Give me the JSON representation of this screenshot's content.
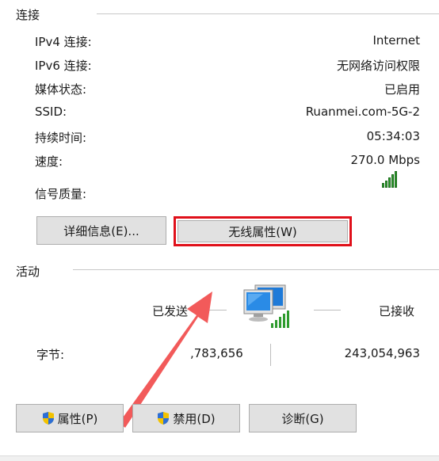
{
  "connection": {
    "group_title": "连接",
    "rows": [
      {
        "label": "IPv4 连接:",
        "value": "Internet"
      },
      {
        "label": "IPv6 连接:",
        "value": "无网络访问权限"
      },
      {
        "label": "媒体状态:",
        "value": "已启用"
      },
      {
        "label": "SSID:",
        "value": "Ruanmei.com-5G-2"
      },
      {
        "label": "持续时间:",
        "value": "05:34:03"
      },
      {
        "label": "速度:",
        "value": "270.0 Mbps"
      }
    ],
    "signal_label": "信号质量:",
    "signal_bars": 5,
    "details_button": "详细信息(E)...",
    "wireless_props_button": "无线属性(W)"
  },
  "activity": {
    "group_title": "活动",
    "sent_label": "已发送",
    "received_label": "已接收",
    "bytes_label": "字节:",
    "bytes_sent": ",783,656",
    "bytes_received": "243,054,963"
  },
  "buttons": {
    "properties": "属性(P)",
    "disable": "禁用(D)",
    "diagnose": "诊断(G)"
  },
  "colors": {
    "highlight_red": "#e0101a",
    "signal_green": "#2e9b2e"
  }
}
